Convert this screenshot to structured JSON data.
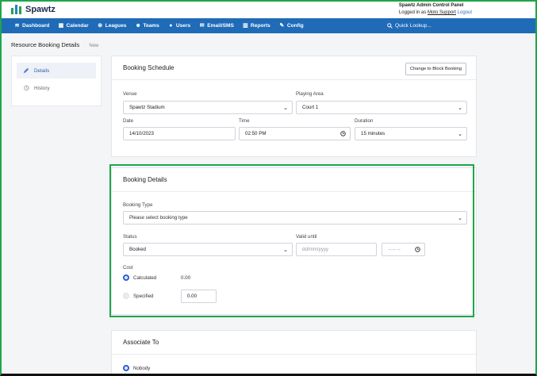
{
  "app": {
    "name": "Spawtz",
    "panel_title": "Spawtz Admin Control Panel",
    "logged_in_prefix": "Logged in as",
    "user": "Moto Support",
    "logout": "Logout"
  },
  "nav": {
    "items": [
      {
        "label": "Dashboard",
        "icon": "layers-icon"
      },
      {
        "label": "Calendar",
        "icon": "calendar-icon"
      },
      {
        "label": "Leagues",
        "icon": "x-circle-icon"
      },
      {
        "label": "Teams",
        "icon": "users-icon"
      },
      {
        "label": "Users",
        "icon": "user-icon"
      },
      {
        "label": "Email/SMS",
        "icon": "envelope-icon"
      },
      {
        "label": "Reports",
        "icon": "chart-icon"
      },
      {
        "label": "Config",
        "icon": "wrench-icon"
      }
    ],
    "quick_lookup": "Quick Lookup..."
  },
  "page": {
    "title": "Resource Booking Details",
    "badge": "New"
  },
  "sidebar": {
    "items": [
      {
        "label": "Details",
        "icon": "pencil-icon",
        "active": true
      },
      {
        "label": "History",
        "icon": "history-icon",
        "active": false
      }
    ]
  },
  "schedule": {
    "heading": "Booking Schedule",
    "block_button": "Change to Block Booking",
    "venue_label": "Venue",
    "venue_value": "Spawtz Stadium",
    "area_label": "Playing Area",
    "area_value": "Court 1",
    "date_label": "Date",
    "date_value": "14/10/2023",
    "time_label": "Time",
    "time_value": "02:50 PM",
    "duration_label": "Duration",
    "duration_value": "15 minutes"
  },
  "details": {
    "heading": "Booking Details",
    "type_label": "Booking Type",
    "type_placeholder": "Please select booking type",
    "status_label": "Status",
    "status_value": "Booked",
    "valid_label": "Valid until",
    "valid_date_placeholder": "dd/mm/yyyy",
    "valid_time_placeholder": "--:-- --",
    "cost_label": "Cost",
    "calculated_label": "Calculated",
    "calculated_value": "0.00",
    "specified_label": "Specified",
    "specified_value": "0.00"
  },
  "associate": {
    "heading": "Associate To",
    "nobody_label": "Nobody"
  },
  "colors": {
    "nav_bg": "#1f6bb8",
    "highlight": "#1fa64a",
    "radio_on": "#2d5fd8"
  }
}
